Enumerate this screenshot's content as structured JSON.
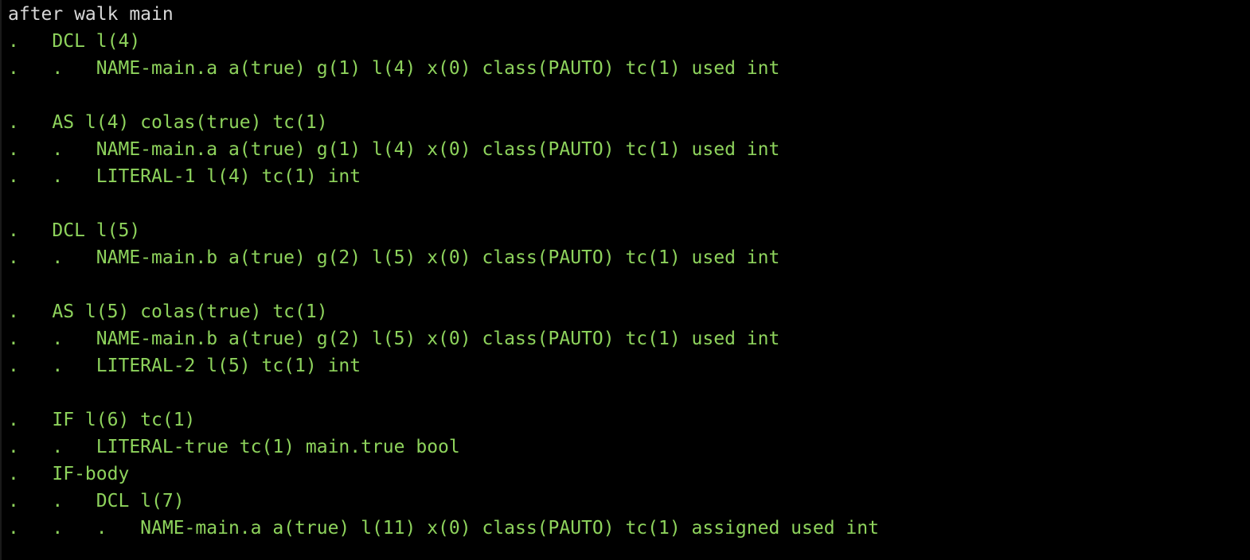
{
  "terminal": {
    "colors": {
      "background": "#000000",
      "header_text": "#d8d8d8",
      "output_text": "#8ed35c"
    },
    "lines": [
      "after walk main",
      ".   DCL l(4)",
      ".   .   NAME-main.a a(true) g(1) l(4) x(0) class(PAUTO) tc(1) used int",
      "",
      ".   AS l(4) colas(true) tc(1)",
      ".   .   NAME-main.a a(true) g(1) l(4) x(0) class(PAUTO) tc(1) used int",
      ".   .   LITERAL-1 l(4) tc(1) int",
      "",
      ".   DCL l(5)",
      ".   .   NAME-main.b a(true) g(2) l(5) x(0) class(PAUTO) tc(1) used int",
      "",
      ".   AS l(5) colas(true) tc(1)",
      ".   .   NAME-main.b a(true) g(2) l(5) x(0) class(PAUTO) tc(1) used int",
      ".   .   LITERAL-2 l(5) tc(1) int",
      "",
      ".   IF l(6) tc(1)",
      ".   .   LITERAL-true tc(1) main.true bool",
      ".   IF-body",
      ".   .   DCL l(7)",
      ".   .   .   NAME-main.a a(true) l(11) x(0) class(PAUTO) tc(1) assigned used int"
    ]
  }
}
